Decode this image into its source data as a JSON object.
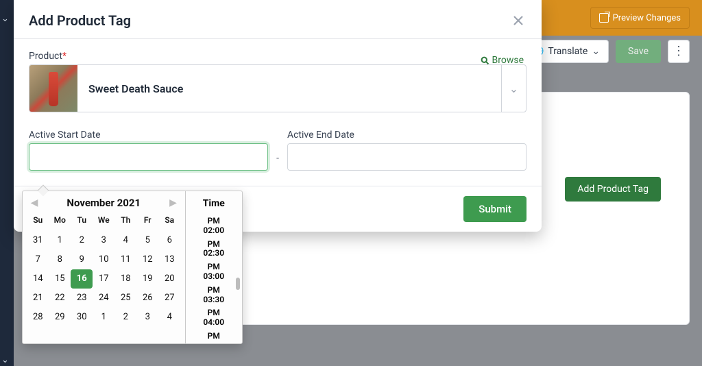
{
  "topbar": {
    "preview_label": "Preview Changes"
  },
  "toolbar": {
    "translate_label": "Translate",
    "save_label": "Save"
  },
  "page": {
    "add_tag_button": "Add Product Tag"
  },
  "modal": {
    "title": "Add Product Tag",
    "product_label": "Product",
    "required_mark": "*",
    "browse_label": "Browse",
    "product_name": "Sweet Death Sauce",
    "start_label": "Active Start Date",
    "end_label": "Active End Date",
    "start_value": "",
    "end_value": "",
    "dash": "-",
    "submit_label": "Submit"
  },
  "datepicker": {
    "month_label": "November 2021",
    "time_header": "Time",
    "dow": [
      "Su",
      "Mo",
      "Tu",
      "We",
      "Th",
      "Fr",
      "Sa"
    ],
    "days": [
      {
        "n": 31
      },
      {
        "n": 1
      },
      {
        "n": 2
      },
      {
        "n": 3
      },
      {
        "n": 4
      },
      {
        "n": 5
      },
      {
        "n": 6
      },
      {
        "n": 7
      },
      {
        "n": 8
      },
      {
        "n": 9
      },
      {
        "n": 10
      },
      {
        "n": 11
      },
      {
        "n": 12
      },
      {
        "n": 13
      },
      {
        "n": 14
      },
      {
        "n": 15
      },
      {
        "n": 16,
        "selected": true
      },
      {
        "n": 17
      },
      {
        "n": 18
      },
      {
        "n": 19
      },
      {
        "n": 20
      },
      {
        "n": 21
      },
      {
        "n": 22
      },
      {
        "n": 23
      },
      {
        "n": 24
      },
      {
        "n": 25
      },
      {
        "n": 26
      },
      {
        "n": 27
      },
      {
        "n": 28
      },
      {
        "n": 29
      },
      {
        "n": 30
      },
      {
        "n": 1
      },
      {
        "n": 2
      },
      {
        "n": 3
      },
      {
        "n": 4
      }
    ],
    "times": [
      {
        "ampm": "PM",
        "t": "02:00"
      },
      {
        "ampm": "PM",
        "t": "02:30"
      },
      {
        "ampm": "PM",
        "t": "03:00"
      },
      {
        "ampm": "PM",
        "t": "03:30"
      },
      {
        "ampm": "PM",
        "t": "04:00"
      },
      {
        "ampm": "PM",
        "t": ""
      }
    ]
  }
}
